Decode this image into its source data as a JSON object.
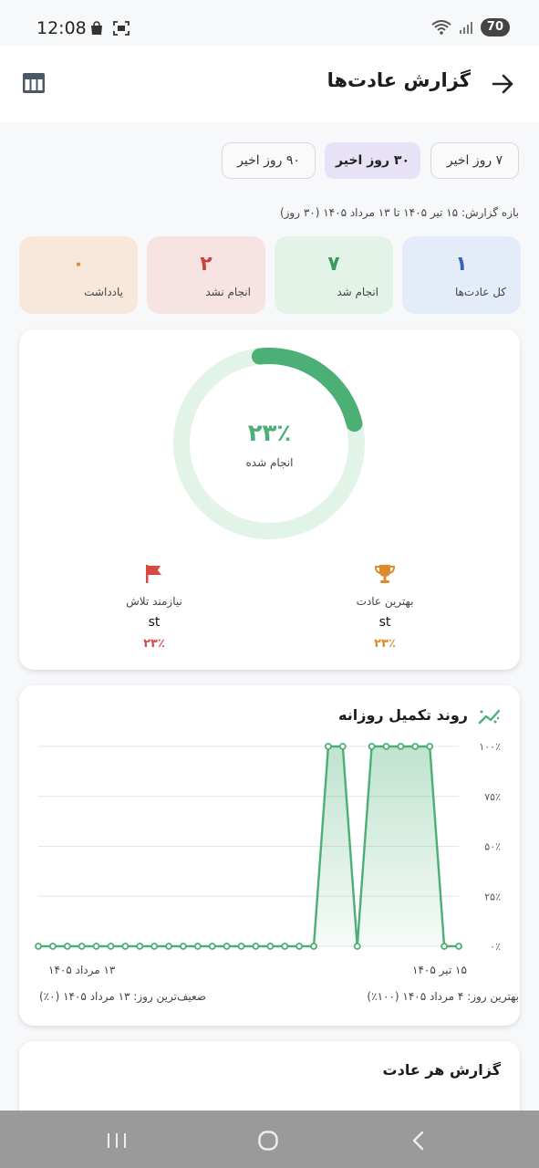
{
  "status": {
    "time": "12:08",
    "battery": "70"
  },
  "header": {
    "title": "گزارش عادت‌ها"
  },
  "range_tabs": [
    {
      "label": "۷ روز اخیر",
      "active": false
    },
    {
      "label": "۳۰ روز اخیر",
      "active": true
    },
    {
      "label": "۹۰ روز اخیر",
      "active": false
    }
  ],
  "range_text": "بازه گزارش: ۱۵ تیر ۱۴۰۵ تا ۱۳ مرداد ۱۴۰۵ (۳۰ روز)",
  "stats": [
    {
      "value": "۱",
      "label": "کل عادت‌ها",
      "bg": "#e4ecfa",
      "color": "#3a62b8"
    },
    {
      "value": "۷",
      "label": "انجام شد",
      "bg": "#e3f3e8",
      "color": "#3c9a5e"
    },
    {
      "value": "۲",
      "label": "انجام نشد",
      "bg": "#f6e3e2",
      "color": "#c9453f"
    },
    {
      "value": "۰",
      "label": "یادداشت",
      "bg": "#f8e8dc",
      "color": "#e0883a"
    }
  ],
  "progress": {
    "percent_text": "۲۳٪",
    "fraction": 0.23,
    "label": "انجام شده",
    "color": "#4caf76",
    "track": "#e2f3e8"
  },
  "best": {
    "label": "بهترین عادت",
    "name": "st",
    "pct": "۲۳٪",
    "color": "#e08a2e",
    "icon": "trophy-icon"
  },
  "worst": {
    "label": "نیازمند تلاش",
    "name": "st",
    "pct": "۲۳٪",
    "color": "#d64a41",
    "icon": "flag-icon"
  },
  "trend": {
    "title": "روند تکمیل روزانه",
    "icon": "trend-icon",
    "y_ticks": [
      "۱۰۰٪",
      "۷۵٪",
      "۵۰٪",
      "۲۵٪",
      "۰٪"
    ],
    "x_start": "۱۵ تیر ۱۴۰۵",
    "x_end": "۱۳ مرداد ۱۴۰۵",
    "best_day": "بهترین روز: ۴ مرداد ۱۴۰۵ (۱۰۰٪)",
    "worst_day": "ضعیف‌ترین روز: ۱۳ مرداد ۱۴۰۵ (۰٪)"
  },
  "chart_data": {
    "type": "area",
    "x_label_start": "۱۵ تیر ۱۴۰۵",
    "x_label_end": "۱۳ مرداد ۱۴۰۵",
    "ylim": [
      0,
      100
    ],
    "y_ticks": [
      0,
      25,
      50,
      75,
      100
    ],
    "grid": true,
    "values": [
      0,
      0,
      100,
      100,
      100,
      100,
      100,
      0,
      100,
      100,
      0,
      0,
      0,
      0,
      0,
      0,
      0,
      0,
      0,
      0,
      0,
      0,
      0,
      0,
      0,
      0,
      0,
      0,
      0,
      0
    ],
    "color": "#4caf76"
  },
  "habit_report": {
    "title": "گزارش هر عادت"
  }
}
